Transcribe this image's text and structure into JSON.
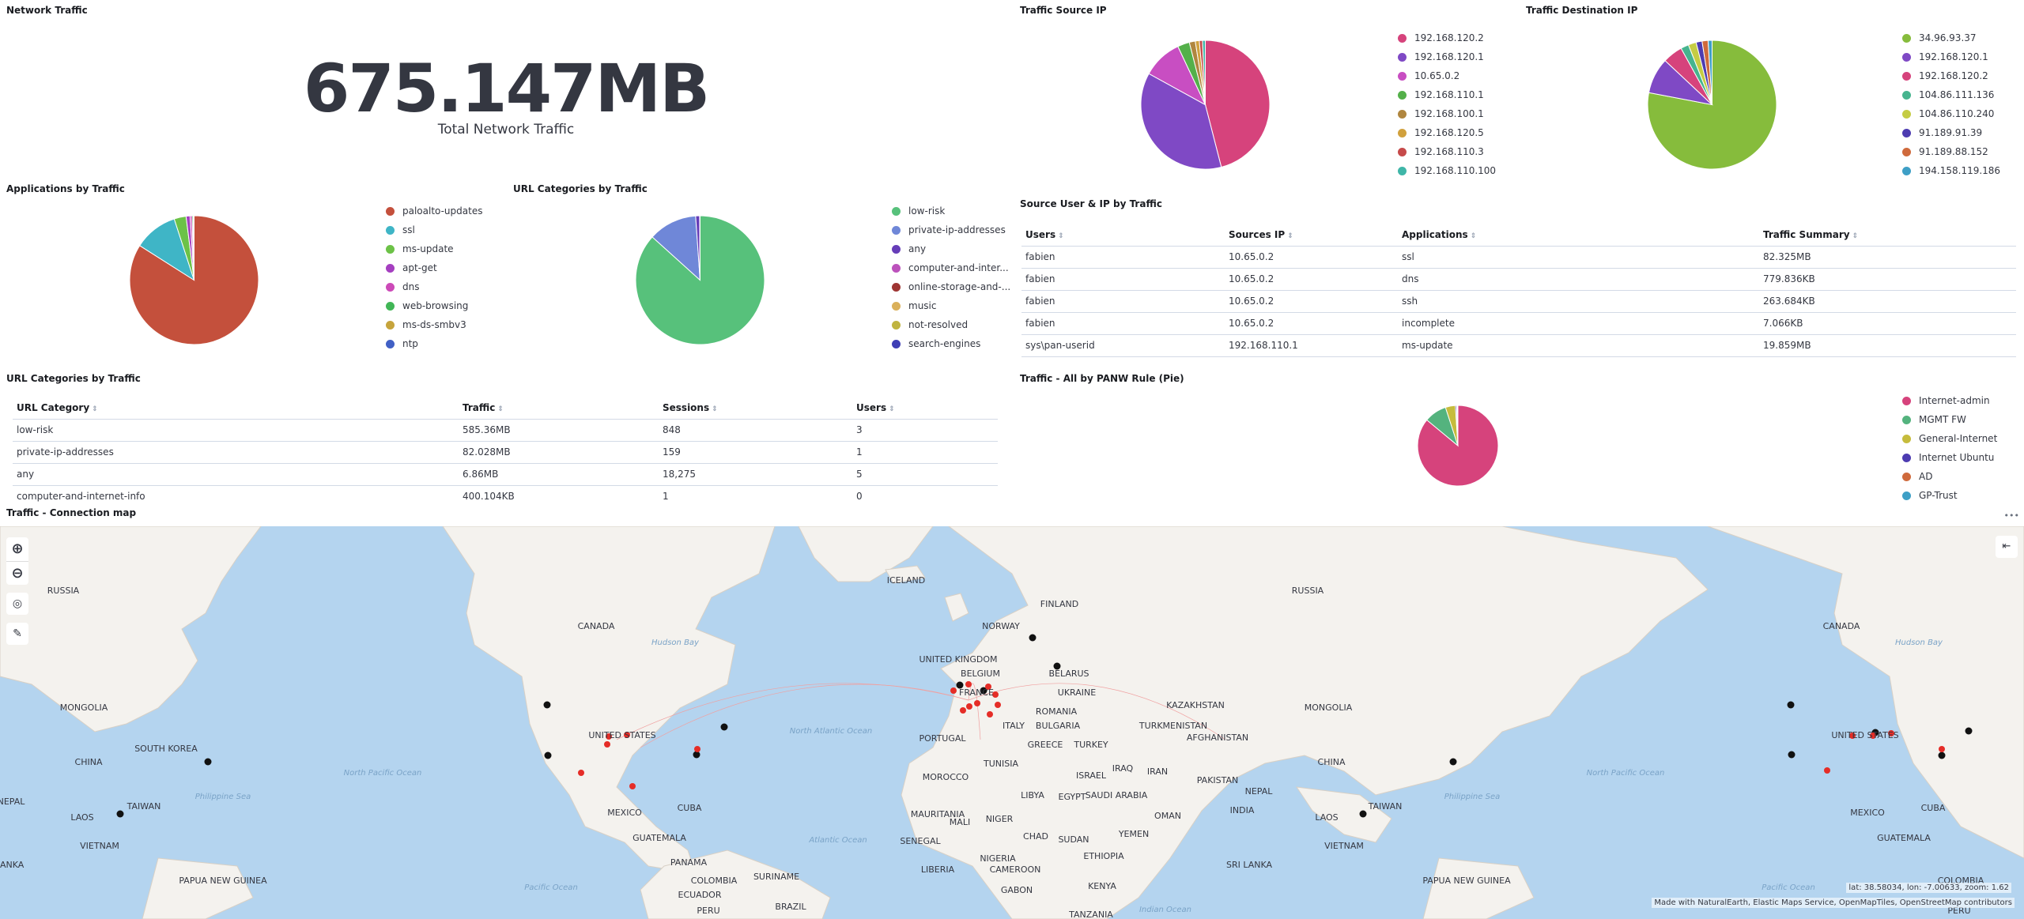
{
  "network_traffic": {
    "title": "Network Traffic",
    "value": "675.147MB",
    "label": "Total Network Traffic"
  },
  "source_ip": {
    "title": "Traffic Source IP",
    "items": [
      {
        "label": "192.168.120.2",
        "color": "#d6437c",
        "value": 46
      },
      {
        "label": "192.168.120.1",
        "color": "#7f49c5",
        "value": 37
      },
      {
        "label": "10.65.0.2",
        "color": "#c84ec2",
        "value": 10
      },
      {
        "label": "192.168.110.1",
        "color": "#54b04a",
        "value": 3
      },
      {
        "label": "192.168.100.1",
        "color": "#b0863f",
        "value": 1.5
      },
      {
        "label": "192.168.120.5",
        "color": "#d1a13d",
        "value": 1
      },
      {
        "label": "192.168.110.3",
        "color": "#c64a4a",
        "value": 0.8
      },
      {
        "label": "192.168.110.100",
        "color": "#3fb6a8",
        "value": 0.7
      }
    ]
  },
  "dest_ip": {
    "title": "Traffic Destination IP",
    "items": [
      {
        "label": "34.96.93.37",
        "color": "#86bc3c",
        "value": 78
      },
      {
        "label": "192.168.120.1",
        "color": "#7f49c5",
        "value": 9
      },
      {
        "label": "192.168.120.2",
        "color": "#d6437c",
        "value": 5
      },
      {
        "label": "104.86.111.136",
        "color": "#46b48e",
        "value": 2
      },
      {
        "label": "104.86.110.240",
        "color": "#c5cc43",
        "value": 2
      },
      {
        "label": "91.189.91.39",
        "color": "#4d3cb1",
        "value": 1.5
      },
      {
        "label": "91.189.88.152",
        "color": "#cf6a3c",
        "value": 1.5
      },
      {
        "label": "194.158.119.186",
        "color": "#3e9fc6",
        "value": 1
      }
    ]
  },
  "applications": {
    "title": "Applications by Traffic",
    "items": [
      {
        "label": "paloalto-updates",
        "color": "#c4503c",
        "value": 84
      },
      {
        "label": "ssl",
        "color": "#3fb5c6",
        "value": 11
      },
      {
        "label": "ms-update",
        "color": "#6cc247",
        "value": 3
      },
      {
        "label": "apt-get",
        "color": "#a53fc0",
        "value": 1
      },
      {
        "label": "dns",
        "color": "#cc4ab8",
        "value": 0.5
      },
      {
        "label": "web-browsing",
        "color": "#41b656",
        "value": 0.3
      },
      {
        "label": "ms-ds-smbv3",
        "color": "#c6a43c",
        "value": 0.1
      },
      {
        "label": "ntp",
        "color": "#4160c5",
        "value": 0.1
      }
    ]
  },
  "url_cat_pie": {
    "title": "URL Categories by Traffic",
    "items": [
      {
        "label": "low-risk",
        "color": "#57c17b",
        "value": 86.7
      },
      {
        "label": "private-ip-addresses",
        "color": "#6f87d8",
        "value": 12.2
      },
      {
        "label": "any",
        "color": "#663db8",
        "value": 1
      },
      {
        "label": "computer-and-inter...",
        "color": "#bc52bc",
        "value": 0.06
      },
      {
        "label": "online-storage-and-...",
        "color": "#9e3533",
        "value": 0.02
      },
      {
        "label": "music",
        "color": "#dab05a",
        "value": 0.01
      },
      {
        "label": "not-resolved",
        "color": "#c0b440",
        "value": 0.01
      },
      {
        "label": "search-engines",
        "color": "#3f3fb5",
        "value": 0.01
      }
    ]
  },
  "source_user": {
    "title": "Source User & IP by Traffic",
    "headers": [
      "Users",
      "Sources IP",
      "Applications",
      "Traffic Summary"
    ],
    "rows": [
      [
        "fabien",
        "10.65.0.2",
        "ssl",
        "82.325MB"
      ],
      [
        "fabien",
        "10.65.0.2",
        "dns",
        "779.836KB"
      ],
      [
        "fabien",
        "10.65.0.2",
        "ssh",
        "263.684KB"
      ],
      [
        "fabien",
        "10.65.0.2",
        "incomplete",
        "7.066KB"
      ],
      [
        "sys\\pan-userid",
        "192.168.110.1",
        "ms-update",
        "19.859MB"
      ]
    ]
  },
  "url_cat_table": {
    "title": "URL Categories by Traffic",
    "headers": [
      "URL Category",
      "Traffic",
      "Sessions",
      "Users"
    ],
    "rows": [
      [
        "low-risk",
        "585.36MB",
        "848",
        "3"
      ],
      [
        "private-ip-addresses",
        "82.028MB",
        "159",
        "1"
      ],
      [
        "any",
        "6.86MB",
        "18,275",
        "5"
      ],
      [
        "computer-and-internet-info",
        "400.104KB",
        "1",
        "0"
      ]
    ]
  },
  "panw_rule": {
    "title": "Traffic - All by PANW Rule (Pie)",
    "items": [
      {
        "label": "Internet-admin",
        "color": "#d6437c",
        "value": 86
      },
      {
        "label": "MGMT FW",
        "color": "#54b37e",
        "value": 9
      },
      {
        "label": "General-Internet",
        "color": "#c6bc3c",
        "value": 4
      },
      {
        "label": "Internet Ubuntu",
        "color": "#4d3cb1",
        "value": 0.5
      },
      {
        "label": "AD",
        "color": "#cf6a3c",
        "value": 0.3
      },
      {
        "label": "GP-Trust",
        "color": "#3e9fc6",
        "value": 0.2
      }
    ]
  },
  "map": {
    "title": "Traffic - Connection map",
    "coords": "lat: 38.58034, lon: -7.00633, zoom: 1.62",
    "attribution": "Made with NaturalEarth, Elastic Maps Service, OpenMapTiles, OpenStreetMap contributors",
    "menu": "•••",
    "labels": [
      "RUSSIA",
      "MONGOLIA",
      "CHINA",
      "SOUTH KOREA",
      "TAIWAN",
      "LAOS",
      "VIETNAM",
      "NEPAL",
      "LANKA",
      "PAPUA NEW GUINEA",
      "CANADA",
      "UNITED STATES",
      "MEXICO",
      "CUBA",
      "GUATEMALA",
      "PANAMA",
      "COLOMBIA",
      "ECUADOR",
      "PERU",
      "BRAZIL",
      "SURINAME",
      "ICELAND",
      "NORWAY",
      "FINLAND",
      "UNITED KINGDOM",
      "BELGIUM",
      "FRANCE",
      "PORTUGAL",
      "ITALY",
      "BELARUS",
      "UKRAINE",
      "ROMANIA",
      "BULGARIA",
      "GREECE",
      "TURKEY",
      "MOROCCO",
      "TUNISIA",
      "LIBYA",
      "EGYPT",
      "MAURITANIA",
      "MALI",
      "NIGER",
      "CHAD",
      "SUDAN",
      "SENEGAL",
      "NIGERIA",
      "LIBERIA",
      "CAMEROON",
      "GABON",
      "ETHIOPIA",
      "KENYA",
      "TANZANIA",
      "SAUDI ARABIA",
      "YEMEN",
      "OMAN",
      "IRAQ",
      "IRAN",
      "ISRAEL",
      "KAZAKHSTAN",
      "TURKMENISTAN",
      "AFGHANISTAN",
      "PAKISTAN",
      "INDIA",
      "NEPAL",
      "SRI LANKA",
      "RUSSIA",
      "MONGOLIA",
      "CHINA",
      "TAIWAN",
      "LAOS",
      "VIETNAM",
      "PAPUA NEW GUINEA",
      "CANADA",
      "UNITED STATES",
      "MEXICO",
      "CUBA",
      "GUATEMALA",
      "COLOMBIA",
      "PERU"
    ],
    "water": [
      "Hudson Bay",
      "North Pacific Ocean",
      "Philippine Sea",
      "North Atlantic Ocean",
      "Atlantic Ocean",
      "Pacific Ocean",
      "Indian Ocean",
      "Hudson Bay",
      "North Atlantic Ocean",
      "North Pacific Ocean",
      "Philippine Sea",
      "Pacific Ocean"
    ]
  }
}
